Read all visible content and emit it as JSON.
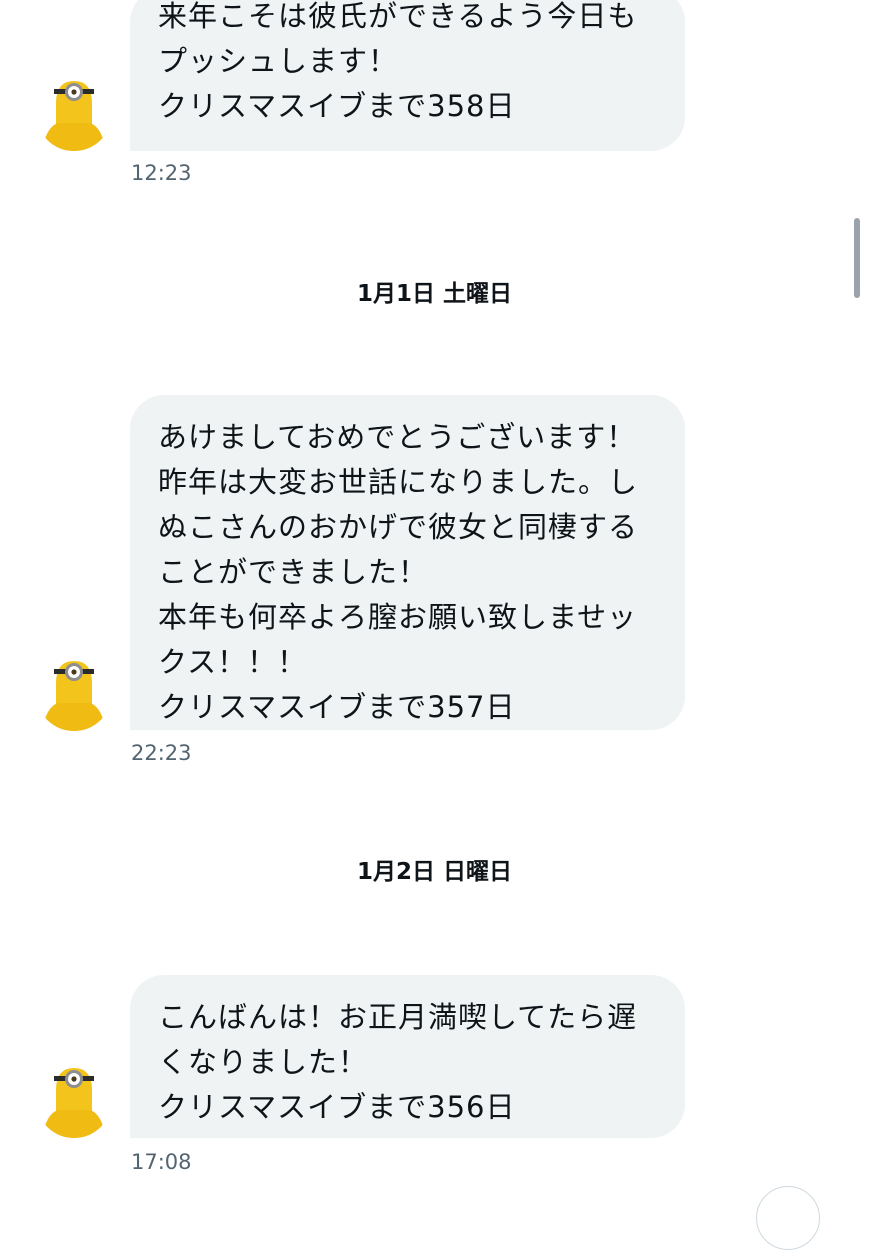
{
  "conversation": {
    "messages": [
      {
        "lines": [
          "来年こそは彼氏ができるよう今日も",
          "プッシュします！",
          "クリスマスイブまで358日"
        ],
        "time": "12:23"
      },
      {
        "lines": [
          "あけましておめでとうございます！",
          "昨年は大変お世話になりました。し",
          "ぬこさんのおかげで彼女と同棲する",
          "ことができました！",
          "本年も何卒よろ膣お願い致しませッ",
          "クス！！！",
          "クリスマスイブまで357日"
        ],
        "time": "22:23"
      },
      {
        "lines": [
          "こんばんは！お正月満喫してたら遅",
          "くなりました！",
          "クリスマスイブまで356日"
        ],
        "time": "17:08"
      }
    ],
    "date_separators": [
      "1月1日 土曜日",
      "1月2日 日曜日"
    ]
  },
  "avatar": {
    "icon": "minion-avatar-icon",
    "colors": {
      "body": "#f3c41c",
      "goggle": "#8e8e8e",
      "eye": "#ffffff",
      "strap": "#2b2b2b"
    }
  },
  "colors": {
    "bubble": "#eff3f4",
    "text": "#0f1419",
    "timestamp": "#536471"
  }
}
